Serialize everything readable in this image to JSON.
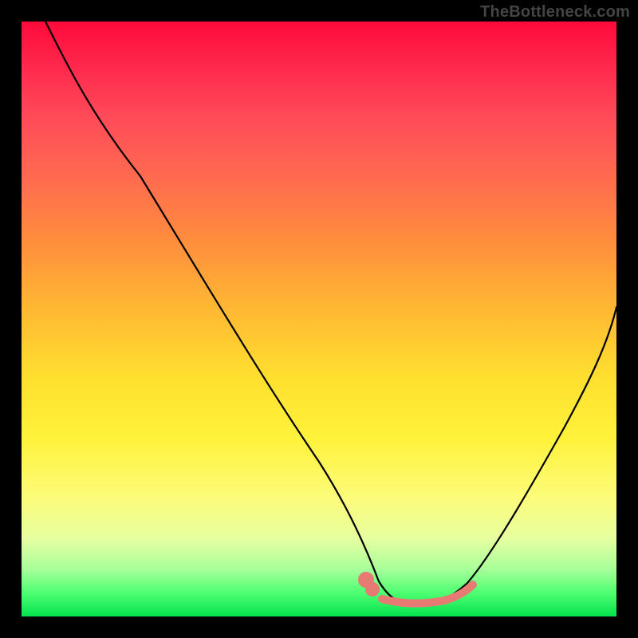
{
  "watermark": "TheBottleneck.com",
  "chart_data": {
    "type": "line",
    "title": "",
    "xlabel": "",
    "ylabel": "",
    "xlim": [
      0,
      100
    ],
    "ylim": [
      0,
      100
    ],
    "grid": false,
    "legend": false,
    "series": [
      {
        "name": "bottleneck-curve",
        "x": [
          4,
          10,
          20,
          30,
          40,
          50,
          58,
          62,
          66,
          70,
          75,
          80,
          88,
          96,
          100
        ],
        "y": [
          100,
          90,
          74,
          58,
          42,
          26,
          12,
          5,
          2,
          2,
          4,
          10,
          24,
          42,
          52
        ],
        "color": "#000000"
      },
      {
        "name": "marker-band",
        "x": [
          58,
          60,
          62,
          64,
          66,
          68,
          70,
          72,
          74,
          76
        ],
        "y": [
          6,
          4.5,
          3.5,
          3,
          2.7,
          2.7,
          3,
          3.5,
          4.5,
          6
        ],
        "color": "#e77a72"
      }
    ],
    "gradient_background": {
      "top_color": "#ff0a3a",
      "bottom_color": "#04e24e",
      "orientation": "vertical"
    },
    "annotations": [
      {
        "type": "highlight-band",
        "x_range": [
          58,
          76
        ],
        "color": "#e77a72"
      }
    ]
  }
}
